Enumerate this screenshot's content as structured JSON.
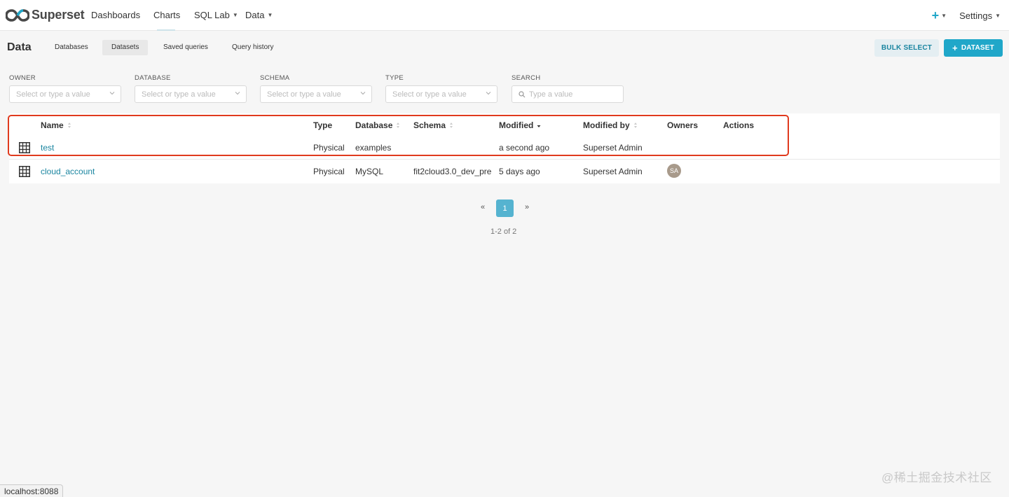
{
  "navbar": {
    "brand": "Superset",
    "items": [
      {
        "label": "Dashboards"
      },
      {
        "label": "Charts"
      },
      {
        "label": "SQL Lab"
      },
      {
        "label": "Data"
      }
    ],
    "plus_label": "+",
    "settings_label": "Settings"
  },
  "subheader": {
    "title": "Data",
    "tabs": [
      {
        "label": "Databases"
      },
      {
        "label": "Datasets"
      },
      {
        "label": "Saved queries"
      },
      {
        "label": "Query history"
      }
    ],
    "active_tab": "Datasets",
    "bulk_select_label": "BULK SELECT",
    "dataset_label": "DATASET"
  },
  "filters": {
    "owner": {
      "label": "OWNER",
      "placeholder": "Select or type a value"
    },
    "database": {
      "label": "DATABASE",
      "placeholder": "Select or type a value"
    },
    "schema": {
      "label": "SCHEMA",
      "placeholder": "Select or type a value"
    },
    "type": {
      "label": "TYPE",
      "placeholder": "Select or type a value"
    },
    "search": {
      "label": "SEARCH",
      "placeholder": "Type a value"
    }
  },
  "table": {
    "headers": {
      "name": "Name",
      "type": "Type",
      "database": "Database",
      "schema": "Schema",
      "modified": "Modified",
      "modified_by": "Modified by",
      "owners": "Owners",
      "actions": "Actions"
    },
    "rows": [
      {
        "name": "test",
        "type": "Physical",
        "database": "examples",
        "schema": "",
        "modified": "a second ago",
        "modified_by": "Superset Admin",
        "owner_initials": ""
      },
      {
        "name": "cloud_account",
        "type": "Physical",
        "database": "MySQL",
        "schema": "fit2cloud3.0_dev_pre",
        "modified": "5 days ago",
        "modified_by": "Superset Admin",
        "owner_initials": "SA"
      }
    ]
  },
  "pagination": {
    "prev": "«",
    "current": "1",
    "next": "»",
    "summary": "1-2 of 2"
  },
  "statusbar": {
    "url": "localhost:8088"
  },
  "watermark": "@稀土掘金技术社区",
  "colors": {
    "accent": "#20a7c9",
    "link": "#1a85a0",
    "highlight_border": "#e03a1e"
  }
}
